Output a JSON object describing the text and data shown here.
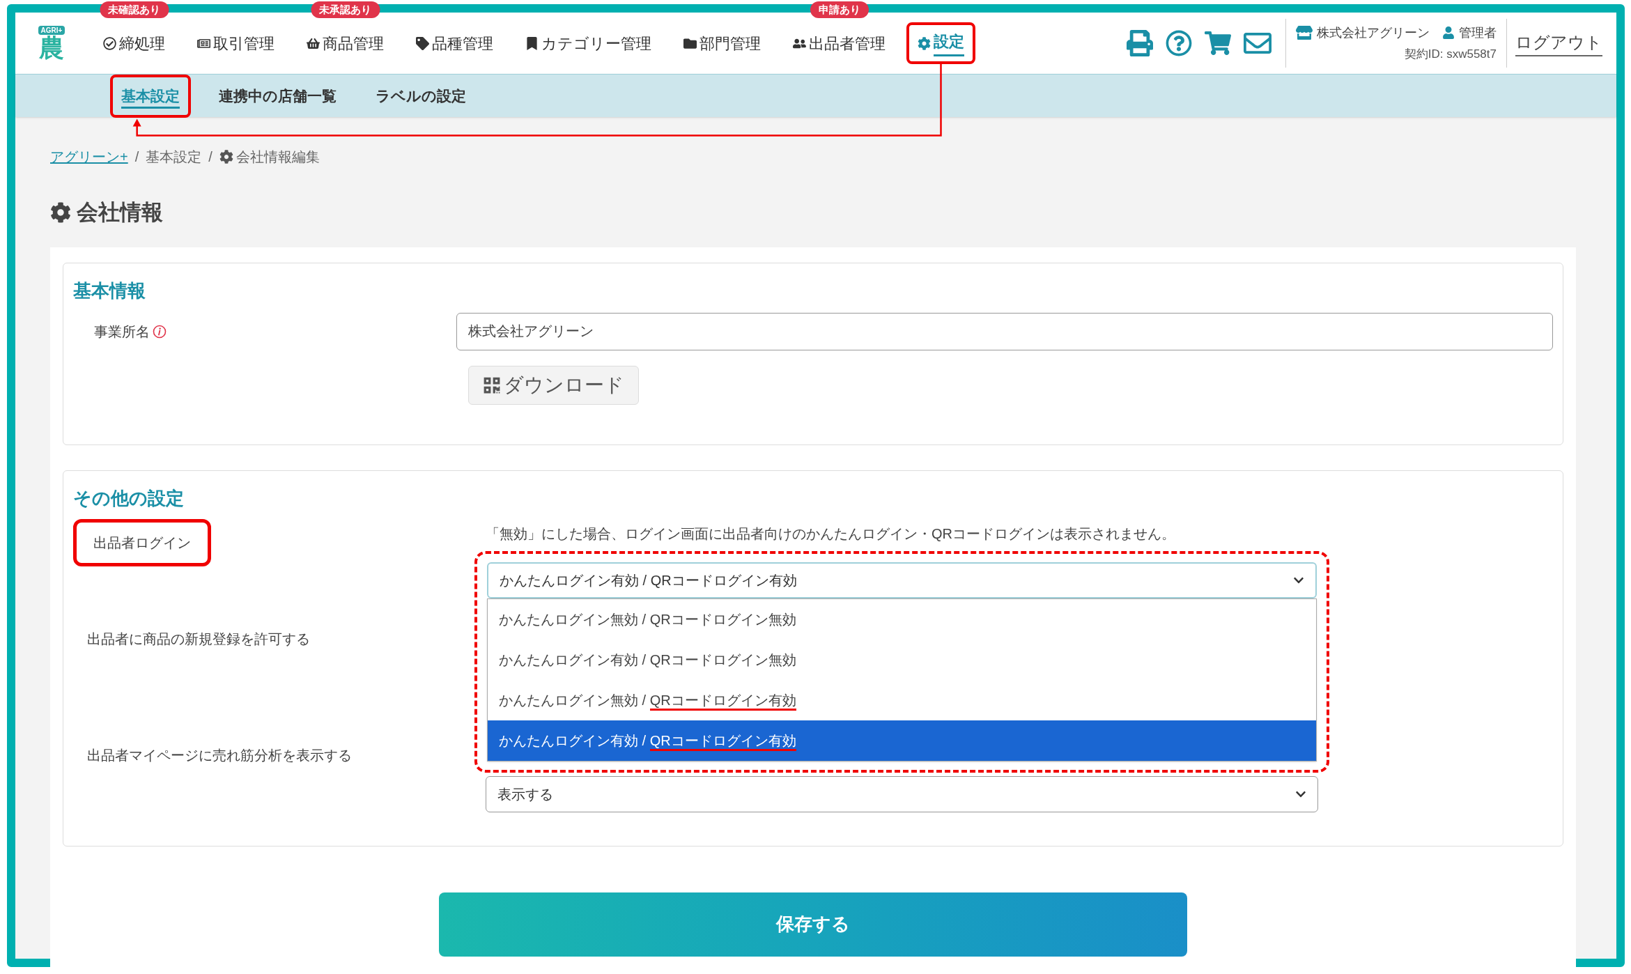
{
  "logo": {
    "text": "AGRI+",
    "mark": "農"
  },
  "nav": [
    {
      "label": "締処理",
      "badge": "未確認あり",
      "selected": false,
      "highlighted": false
    },
    {
      "label": "取引管理",
      "selected": false,
      "highlighted": false
    },
    {
      "label": "商品管理",
      "badge": "未承認あり",
      "selected": false,
      "highlighted": false
    },
    {
      "label": "品種管理",
      "selected": false,
      "highlighted": false
    },
    {
      "label": "カテゴリー管理",
      "selected": false,
      "highlighted": false
    },
    {
      "label": "部門管理",
      "selected": false,
      "highlighted": false
    },
    {
      "label": "出品者管理",
      "badge": "申請あり",
      "selected": false,
      "highlighted": false
    },
    {
      "label": "設定",
      "selected": true,
      "highlighted": true
    }
  ],
  "account": {
    "company": "株式会社アグリーン",
    "user": "管理者",
    "contract_id": "契約ID: sxw558t7",
    "logout": "ログアウト"
  },
  "subnav": [
    {
      "label": "基本設定",
      "selected": true,
      "highlighted": true
    },
    {
      "label": "連携中の店舗一覧",
      "selected": false,
      "highlighted": false
    },
    {
      "label": "ラベルの設定",
      "selected": false,
      "highlighted": false
    }
  ],
  "breadcrumb": [
    {
      "label": "アグリーン+",
      "kind": "link"
    },
    {
      "separator": "/",
      "label": "基本設定",
      "kind": "text"
    },
    {
      "separator": "/",
      "label": "会社情報編集",
      "kind": "current"
    }
  ],
  "page_title": "会社情報",
  "basic_info": {
    "title": "基本情報",
    "office_name": {
      "label": "事業所名",
      "value": "株式会社アグリーン"
    },
    "download_button": "ダウンロード"
  },
  "other_settings": {
    "title": "その他の設定",
    "seller_login": {
      "label": "出品者ログイン",
      "highlighted": true,
      "note": "「無効」にした場合、ログイン画面に出品者向けのかんたんログイン・QRコードログインは表示されません。",
      "select": {
        "value": "かんたんログイン有効 / QRコードログイン有効",
        "expanded": true,
        "highlighted": true,
        "options": [
          {
            "parts": [
              "かんたんログイン無効 / ",
              "QRコードログイン無効"
            ],
            "selected": false,
            "underlined": false
          },
          {
            "parts": [
              "かんたんログイン有効 / ",
              "QRコードログイン無効"
            ],
            "selected": false,
            "underlined": false
          },
          {
            "parts": [
              "かんたんログイン無効 / ",
              "QRコードログイン有効"
            ],
            "selected": false,
            "underlined": true
          },
          {
            "parts": [
              "かんたんログイン有効 / ",
              "QRコードログイン有効"
            ],
            "selected": true,
            "underlined": true
          }
        ]
      }
    },
    "allow_registration": {
      "label": "出品者に商品の新規登録を許可する"
    },
    "show_analysis": {
      "label": "出品者マイページに売れ筋分析を表示する",
      "select": {
        "value": "表示する",
        "expanded": false
      }
    }
  },
  "save_button": "保存する"
}
